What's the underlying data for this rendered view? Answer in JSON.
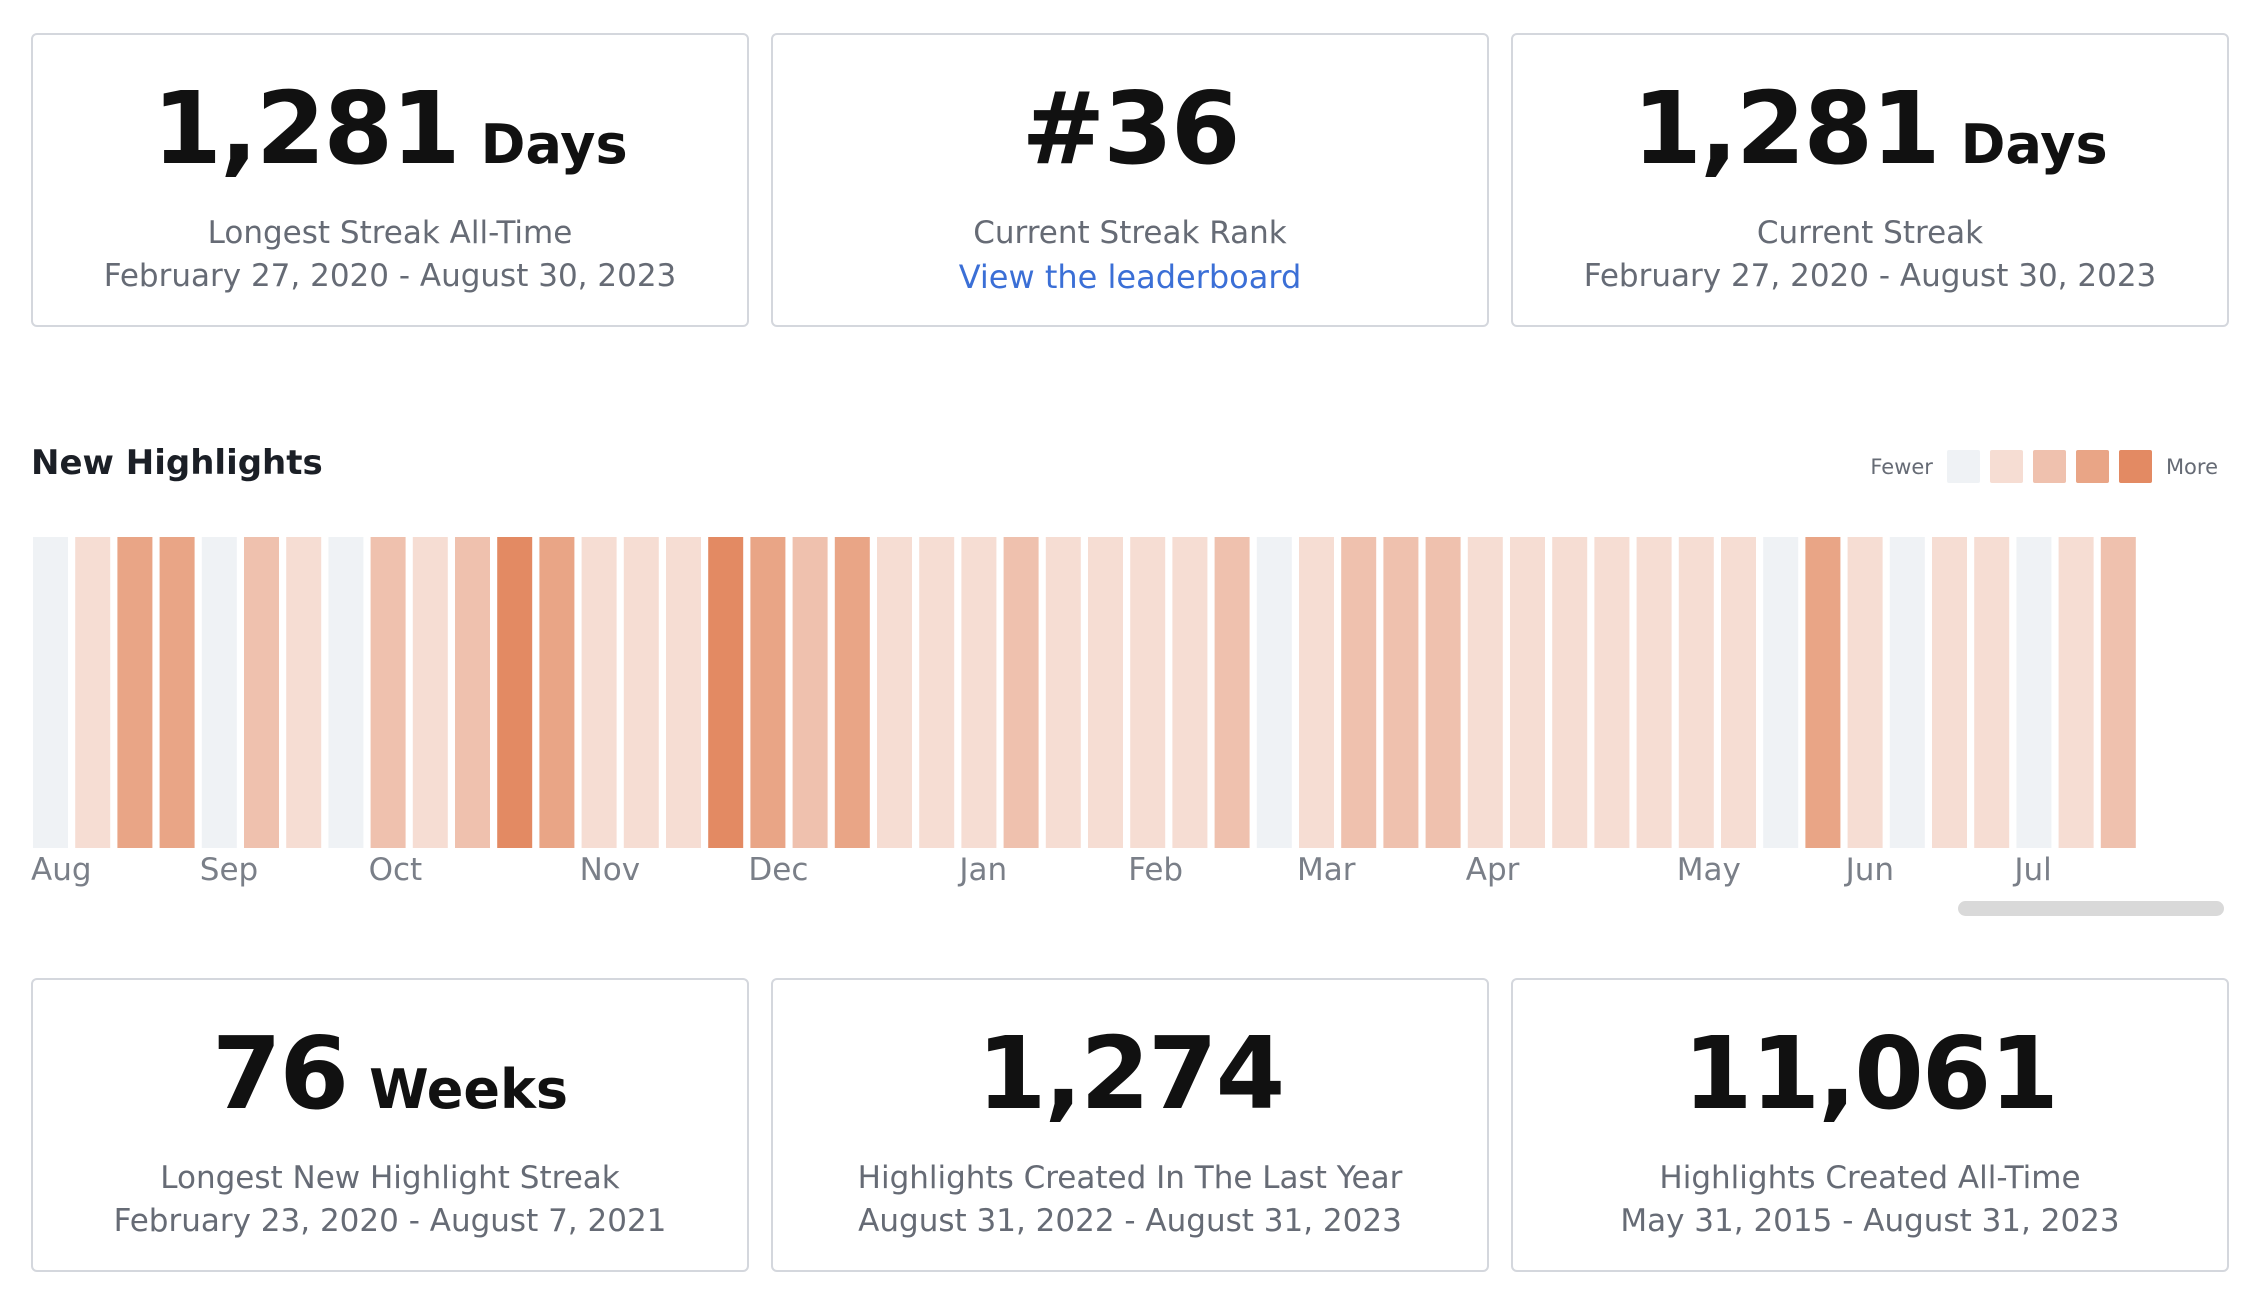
{
  "top_cards": [
    {
      "value": "1,281",
      "unit": "Days",
      "label": "Longest Streak All-Time",
      "sub": "February 27, 2020 - August 30, 2023"
    },
    {
      "value": "#36",
      "label": "Current Streak Rank",
      "link": "View the leaderboard"
    },
    {
      "value": "1,281",
      "unit": "Days",
      "label": "Current Streak",
      "sub": "February 27, 2020 - August 30, 2023"
    }
  ],
  "bottom_cards": [
    {
      "value": "76",
      "unit": "Weeks",
      "label": "Longest New Highlight Streak",
      "sub": "February 23, 2020 - August 7, 2021"
    },
    {
      "value": "1,274",
      "label": "Highlights Created In The Last Year",
      "sub": "August 31, 2022 - August 31, 2023"
    },
    {
      "value": "11,061",
      "label": "Highlights Created All-Time",
      "sub": "May 31, 2015 - August 31, 2023"
    }
  ],
  "highlights": {
    "title": "New Highlights",
    "legend": {
      "fewer": "Fewer",
      "more": "More"
    },
    "colors": [
      "#eff2f5",
      "#f6ddd3",
      "#efc1ae",
      "#e9a586",
      "#e38a63"
    ]
  },
  "chart_data": {
    "type": "heatmap",
    "title": "New Highlights",
    "levels": [
      0,
      1,
      3,
      3,
      0,
      2,
      1,
      0,
      2,
      1,
      2,
      4,
      3,
      1,
      1,
      1,
      4,
      3,
      2,
      3,
      1,
      1,
      1,
      2,
      1,
      1,
      1,
      1,
      2,
      0,
      1,
      2,
      2,
      2,
      1,
      1,
      1,
      1,
      1,
      1,
      1,
      0,
      3,
      1,
      0,
      1,
      1,
      0,
      1,
      2
    ],
    "month_labels": [
      {
        "label": "Aug",
        "week": 0
      },
      {
        "label": "Sep",
        "week": 4
      },
      {
        "label": "Oct",
        "week": 8
      },
      {
        "label": "Nov",
        "week": 13
      },
      {
        "label": "Dec",
        "week": 17
      },
      {
        "label": "Jan",
        "week": 22
      },
      {
        "label": "Feb",
        "week": 26
      },
      {
        "label": "Mar",
        "week": 30
      },
      {
        "label": "Apr",
        "week": 34
      },
      {
        "label": "May",
        "week": 39
      },
      {
        "label": "Jun",
        "week": 43
      },
      {
        "label": "Jul",
        "week": 47
      }
    ]
  }
}
